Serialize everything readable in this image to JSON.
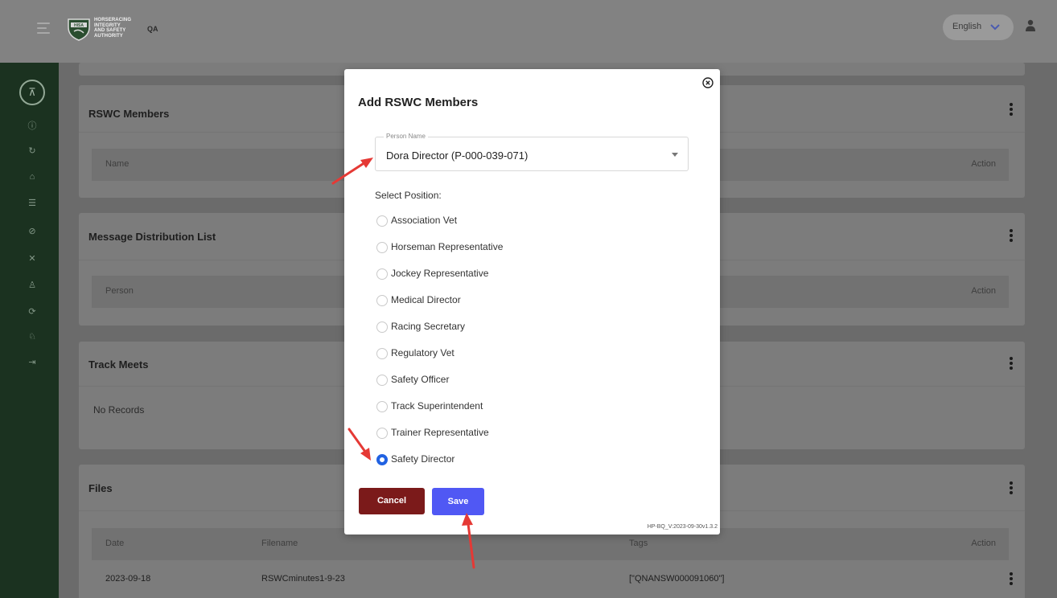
{
  "header": {
    "logo_text_lines": [
      "HORSERACING",
      "INTEGRITY",
      "AND SAFETY",
      "AUTHORITY"
    ],
    "logo_badge": "HISA",
    "environment": "QA",
    "language": "English"
  },
  "cards": {
    "rswc_members": {
      "title": "RSWC Members",
      "col_name": "Name",
      "col_action": "Action"
    },
    "message_distribution": {
      "title": "Message Distribution List",
      "col_person": "Person",
      "col_action": "Action"
    },
    "track_meets": {
      "title": "Track Meets",
      "empty_text": "No Records"
    },
    "files": {
      "title": "Files",
      "col_date": "Date",
      "col_filename": "Filename",
      "col_tags": "Tags",
      "col_action": "Action",
      "rows": [
        {
          "date": "2023-09-18",
          "filename": "RSWCminutes1-9-23",
          "tags": "[\"QNANSW000091060\"]"
        }
      ]
    }
  },
  "modal": {
    "title": "Add RSWC Members",
    "person_name_label": "Person Name",
    "person_name_value": "Dora Director (P-000-039-071)",
    "select_position_label": "Select Position:",
    "positions": [
      {
        "label": "Association Vet",
        "checked": false
      },
      {
        "label": "Horseman Representative",
        "checked": false
      },
      {
        "label": "Jockey Representative",
        "checked": false
      },
      {
        "label": "Medical Director",
        "checked": false
      },
      {
        "label": "Racing Secretary",
        "checked": false
      },
      {
        "label": "Regulatory Vet",
        "checked": false
      },
      {
        "label": "Safety Officer",
        "checked": false
      },
      {
        "label": "Track Superintendent",
        "checked": false
      },
      {
        "label": "Trainer Representative",
        "checked": false
      },
      {
        "label": "Safety Director",
        "checked": true
      }
    ],
    "cancel_label": "Cancel",
    "save_label": "Save",
    "version": "HP-BQ_V:2023-09-30v1.3.2"
  },
  "colors": {
    "sidebar": "#1b3220",
    "cancel": "#7b1a1a",
    "save": "#5058f4",
    "radio_checked": "#2162e2",
    "annotation_arrow": "#e53935"
  }
}
